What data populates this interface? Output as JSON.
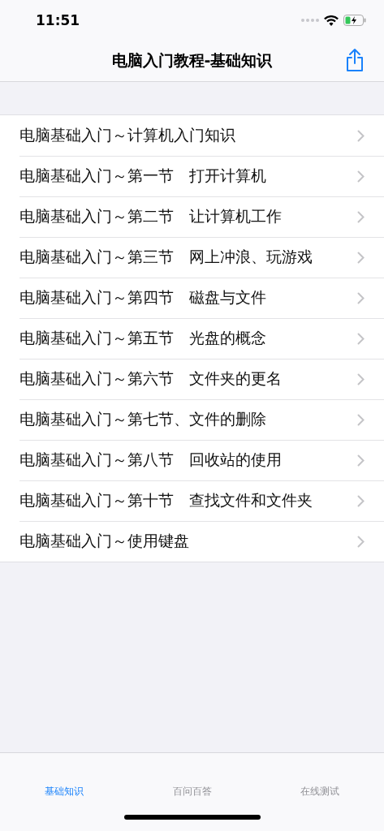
{
  "status_bar": {
    "time": "11:51"
  },
  "nav": {
    "title": "电脑入门教程-基础知识"
  },
  "lessons": [
    {
      "title": "电脑基础入门～计算机入门知识"
    },
    {
      "title": "电脑基础入门～第一节　打开计算机"
    },
    {
      "title": "电脑基础入门～第二节　让计算机工作"
    },
    {
      "title": "电脑基础入门～第三节　网上冲浪、玩游戏"
    },
    {
      "title": "电脑基础入门～第四节　磁盘与文件"
    },
    {
      "title": "电脑基础入门～第五节　光盘的概念"
    },
    {
      "title": "电脑基础入门～第六节　文件夹的更名"
    },
    {
      "title": "电脑基础入门～第七节、文件的删除"
    },
    {
      "title": "电脑基础入门～第八节　回收站的使用"
    },
    {
      "title": "电脑基础入门～第十节　查找文件和文件夹"
    },
    {
      "title": "电脑基础入门～使用键盘"
    }
  ],
  "tabs": [
    {
      "label": "基础知识",
      "selected": true
    },
    {
      "label": "百问百答",
      "selected": false
    },
    {
      "label": "在线测试",
      "selected": false
    }
  ]
}
